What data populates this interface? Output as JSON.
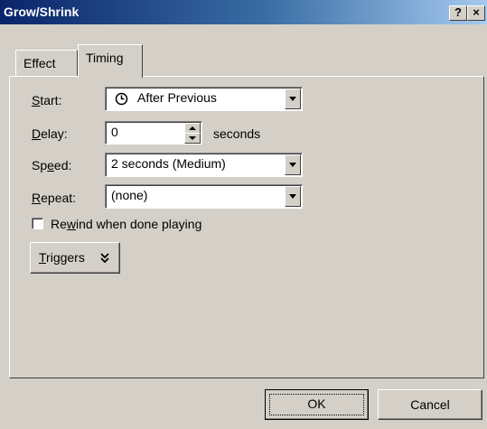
{
  "window": {
    "title": "Grow/Shrink",
    "help_button": "?",
    "close_button": "×"
  },
  "tabs": [
    {
      "label": "Effect",
      "selected": false
    },
    {
      "label": "Timing",
      "selected": true
    }
  ],
  "timing": {
    "start": {
      "label_key": "S",
      "label_rest": "tart:",
      "value": "After Previous",
      "icon": "clock-icon"
    },
    "delay": {
      "label_key": "D",
      "label_rest": "elay:",
      "value": "0",
      "unit": "seconds"
    },
    "speed": {
      "label_pre": "Sp",
      "label_key": "e",
      "label_rest": "ed:",
      "value": "2 seconds (Medium)"
    },
    "repeat": {
      "label_key": "R",
      "label_rest": "epeat:",
      "value": "(none)"
    },
    "rewind": {
      "label_pre": "Re",
      "label_key": "w",
      "label_rest": "ind when done playing",
      "checked": false
    },
    "triggers": {
      "label_key": "T",
      "label_rest": "riggers",
      "icon": "double-chevron-down-icon"
    }
  },
  "buttons": {
    "ok": "OK",
    "cancel": "Cancel"
  },
  "colors": {
    "dialog_face": "#d4d0c8",
    "title_start": "#0a246a",
    "title_end": "#a6caf0"
  }
}
